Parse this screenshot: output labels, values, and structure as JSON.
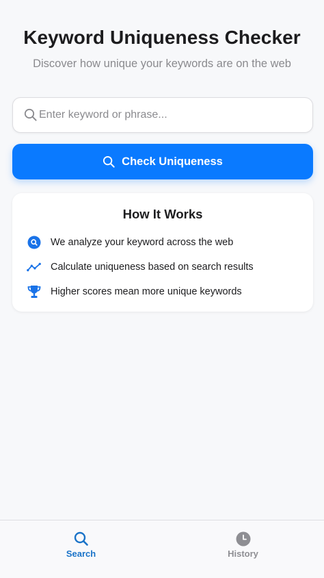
{
  "header": {
    "title": "Keyword Uniqueness Checker",
    "subtitle": "Discover how unique your keywords are on the web"
  },
  "search": {
    "value": "",
    "placeholder": "Enter keyword or phrase...",
    "icon": "search-icon"
  },
  "check_button": {
    "label": "Check Uniqueness",
    "icon": "search-icon"
  },
  "how_it_works": {
    "title": "How It Works",
    "steps": [
      {
        "icon": "search-circle-icon",
        "text": "We analyze your keyword across the web"
      },
      {
        "icon": "trending-line-icon",
        "text": "Calculate uniqueness based on search results"
      },
      {
        "icon": "trophy-icon",
        "text": "Higher scores mean more unique keywords"
      }
    ]
  },
  "tabbar": {
    "tabs": [
      {
        "label": "Search",
        "icon": "search-icon",
        "active": true
      },
      {
        "label": "History",
        "icon": "clock-icon",
        "active": false
      }
    ]
  },
  "colors": {
    "accent": "#0a7aff",
    "tab_active": "#1a73c8",
    "tab_inactive": "#8e8e93",
    "background": "#f7f8fa"
  }
}
